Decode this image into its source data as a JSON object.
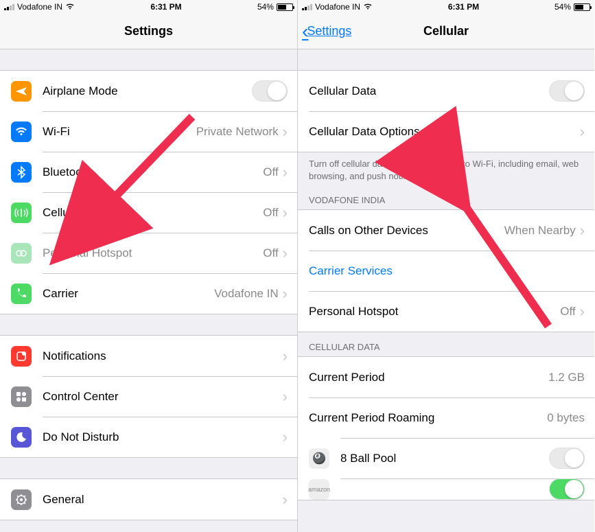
{
  "status": {
    "carrier": "Vodafone IN",
    "time": "6:31 PM",
    "battery": "54%"
  },
  "left": {
    "title": "Settings",
    "g1": [
      {
        "label": "Airplane Mode",
        "type": "toggle",
        "on": false,
        "icon": "airplane",
        "color": "#ff9500"
      },
      {
        "label": "Wi-Fi",
        "value": "Private Network",
        "icon": "wifi",
        "color": "#007aff"
      },
      {
        "label": "Bluetooth",
        "value": "Off",
        "icon": "bluetooth",
        "color": "#007aff"
      },
      {
        "label": "Cellular",
        "value": "Off",
        "icon": "antenna",
        "color": "#4cd964"
      },
      {
        "label": "Personal Hotspot",
        "value": "Off",
        "icon": "hotspot",
        "color": "#4cd964",
        "dim": true
      },
      {
        "label": "Carrier",
        "value": "Vodafone IN",
        "icon": "phone",
        "color": "#4cd964"
      }
    ],
    "g2": [
      {
        "label": "Notifications",
        "icon": "notif",
        "color": "#ff3b30"
      },
      {
        "label": "Control Center",
        "icon": "cc",
        "color": "#8e8e93"
      },
      {
        "label": "Do Not Disturb",
        "icon": "dnd",
        "color": "#5856d6"
      }
    ],
    "g3": [
      {
        "label": "General",
        "icon": "gear",
        "color": "#8e8e93"
      }
    ]
  },
  "right": {
    "back": "Settings",
    "title": "Cellular",
    "g1": [
      {
        "label": "Cellular Data",
        "type": "toggle",
        "on": false
      },
      {
        "label": "Cellular Data Options",
        "type": "nav"
      }
    ],
    "foot1": "Turn off cellular data to restrict all data to Wi-Fi, including email, web browsing, and push notifications.",
    "head1": "VODAFONE INDIA",
    "g2": [
      {
        "label": "Calls on Other Devices",
        "value": "When Nearby"
      },
      {
        "label": "Carrier Services",
        "link": true
      },
      {
        "label": "Personal Hotspot",
        "value": "Off"
      }
    ],
    "head2": "CELLULAR DATA",
    "g3": [
      {
        "label": "Current Period",
        "value": "1.2 GB",
        "plain": true
      },
      {
        "label": "Current Period Roaming",
        "value": "0 bytes",
        "plain": true
      },
      {
        "label": "8 Ball Pool",
        "type": "apptoggle",
        "on": false,
        "app": true
      },
      {
        "label": "amazon",
        "type": "apptoggle",
        "on": true,
        "app": true
      }
    ]
  }
}
